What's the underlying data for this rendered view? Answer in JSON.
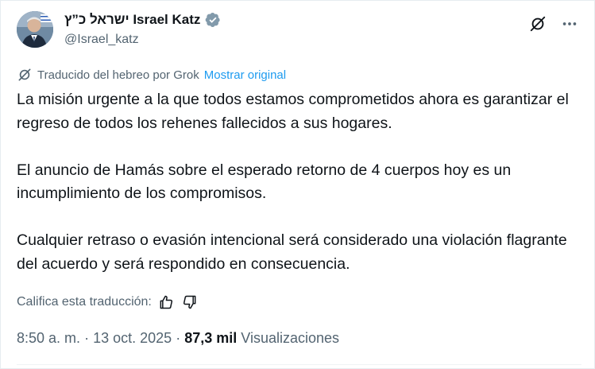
{
  "author": {
    "display_name": "ישראל כ”ץ Israel Katz",
    "handle": "@Israel_katz",
    "verified_color": "#829aab"
  },
  "header_actions": {
    "grok_icon": "grok-icon",
    "more_icon": "more-horizontal-icon"
  },
  "translation": {
    "note": "Traducido del hebreo por Grok",
    "show_original": "Mostrar original"
  },
  "tweet": {
    "paragraphs": [
      "La misión urgente a la que todos estamos comprometidos ahora es garantizar el regreso de todos los rehenes fallecidos a sus hogares.",
      "El anuncio de Hamás sobre el esperado retorno de 4 cuerpos hoy es un incumplimiento de los compromisos.",
      "Cualquier retraso o evasión intencional será considerado una violación flagrante del acuerdo y será respondido en consecuencia."
    ]
  },
  "rating": {
    "label": "Califica esta traducción:",
    "thumbs_up_icon": "thumbs-up-icon",
    "thumbs_down_icon": "thumbs-down-icon"
  },
  "meta": {
    "time": "8:50 a. m.",
    "separator": "·",
    "date": "13 oct. 2025",
    "views_count": "87,3 mil",
    "views_label": "Visualizaciones"
  },
  "colors": {
    "link": "#1d9bf0",
    "secondary_text": "#536471",
    "primary_text": "#0f1419"
  }
}
